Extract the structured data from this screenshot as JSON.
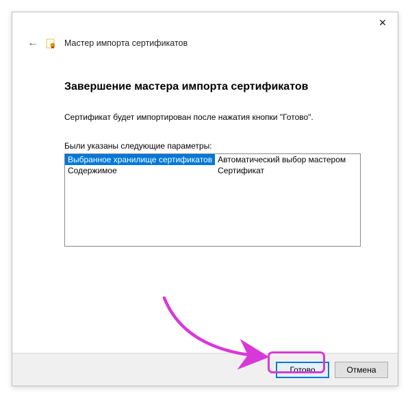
{
  "window": {
    "title": "Мастер импорта сертификатов",
    "close_glyph": "✕"
  },
  "page": {
    "heading": "Завершение мастера импорта сертификатов",
    "description": "Сертификат будет импортирован после нажатия кнопки \"Готово\".",
    "params_label": "Были указаны следующие параметры:"
  },
  "params": {
    "rows": [
      {
        "key": "Выбранное хранилище сертификатов",
        "value": "Автоматический выбор мастером",
        "selected": true
      },
      {
        "key": "Содержимое",
        "value": "Сертификат",
        "selected": false
      }
    ]
  },
  "buttons": {
    "finish": "Готово",
    "cancel": "Отмена"
  },
  "colors": {
    "accent": "#0078d7",
    "highlight": "#d838d8"
  }
}
